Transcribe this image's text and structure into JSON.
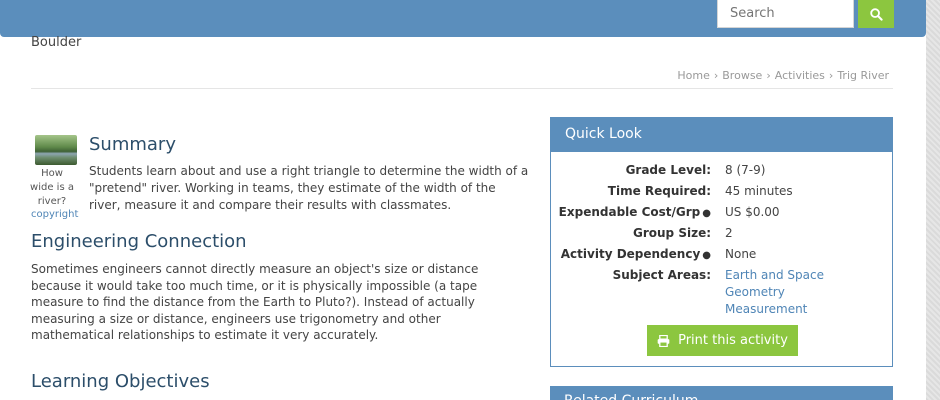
{
  "header": {
    "search_placeholder": "Search",
    "search_icon": "search-icon"
  },
  "org_name": "Boulder",
  "breadcrumb": [
    "Home",
    "Browse",
    "Activities",
    "Trig River"
  ],
  "thumbnail": {
    "caption": "How wide is a river?",
    "copyright": "copyright"
  },
  "summary": {
    "title": "Summary",
    "text": "Students learn about and use a right triangle to determine the width of a \"pretend\" river. Working in teams, they estimate of the width of the river, measure it and compare their results with classmates."
  },
  "engineering_connection": {
    "title": "Engineering Connection",
    "text": "Sometimes engineers cannot directly measure an object's size or distance because it would take too much time, or it is physically impossible (a tape measure to find the distance from the Earth to Pluto?). Instead of actually measuring a size or distance, engineers use trigonometry and other mathematical relationships to estimate it very accurately."
  },
  "learning_objectives": {
    "title": "Learning Objectives"
  },
  "quick_look": {
    "title": "Quick Look",
    "grade_level_label": "Grade Level:",
    "grade_level_value": "8 (7-9)",
    "time_required_label": "Time Required:",
    "time_required_value": "45 minutes",
    "expendable_cost_label": "Expendable Cost/Grp",
    "expendable_cost_value": "US $0.00",
    "group_size_label": "Group Size:",
    "group_size_value": "2",
    "activity_dependency_label": "Activity Dependency",
    "activity_dependency_value": "None",
    "subject_areas_label": "Subject Areas:",
    "subject_areas": [
      "Earth and Space",
      "Geometry",
      "Measurement"
    ],
    "print_label": "Print this activity"
  },
  "related_panel_title": "Related Curriculum",
  "colors": {
    "header_blue": "#5b8ebc",
    "accent_green": "#8cc63f",
    "link_blue": "#4f85b6",
    "heading_blue": "#2c4e6a"
  }
}
